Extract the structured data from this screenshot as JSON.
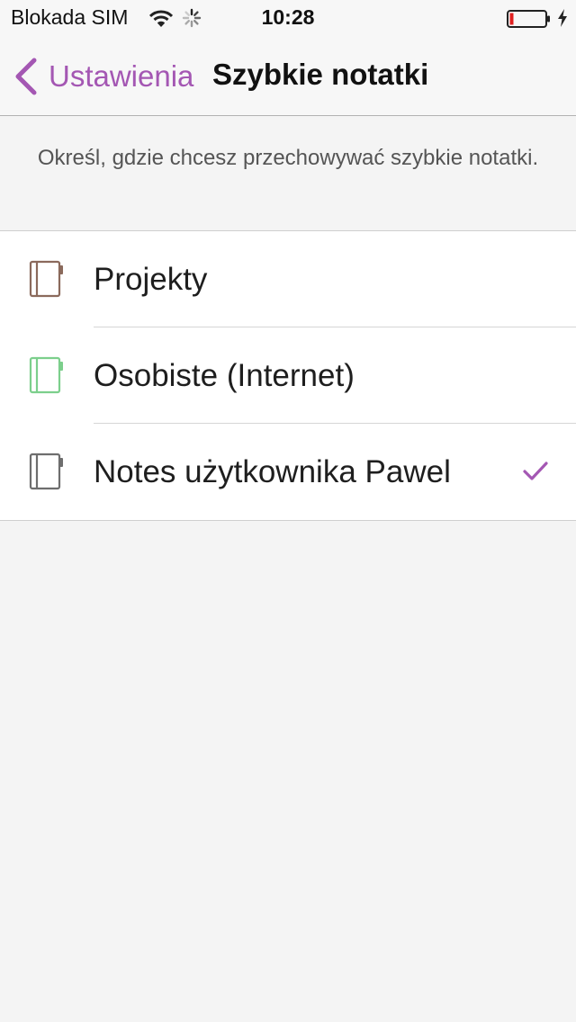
{
  "status_bar": {
    "carrier": "Blokada SIM",
    "time": "10:28"
  },
  "nav": {
    "back_label": "Ustawienia",
    "title": "Szybkie notatki"
  },
  "description": "Określ, gdzie chcesz przechowywać szybkie notatki.",
  "notebooks": [
    {
      "label": "Projekty",
      "icon": "notebook-icon",
      "color": "#8b6a5c",
      "selected": false
    },
    {
      "label": "Osobiste (Internet)",
      "icon": "notebook-icon",
      "color": "#7ccf8c",
      "selected": false
    },
    {
      "label": "Notes użytkownika Pawel",
      "icon": "notebook-icon",
      "color": "#6e6e6e",
      "selected": true
    }
  ],
  "colors": {
    "accent": "#a457b3",
    "battery_low": "#e02020"
  }
}
